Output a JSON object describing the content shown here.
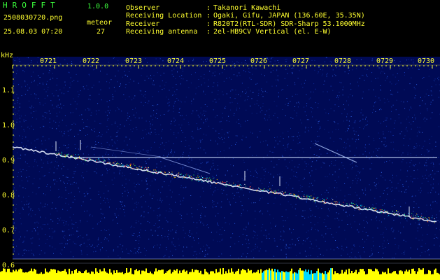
{
  "header": {
    "app_name": "HROFFT",
    "app_version": "1.0.0",
    "filename": "2508030720.png",
    "timestamp": "25.08.03 07:20",
    "counter_label": "meteor",
    "counter_value": "27",
    "fields": [
      {
        "label": "Observer",
        "value": "Takanori Kawachi"
      },
      {
        "label": "Receiving Location",
        "value": "Ogaki, Gifu, JAPAN (136.60E, 35.35N)"
      },
      {
        "label": "Receiver",
        "value": "R820T2(RTL-SDR) SDR-Sharp 53.1000MHz"
      },
      {
        "label": "Receiving antenna",
        "value": "2el-HB9CV Vertical (el. E-W)"
      }
    ]
  },
  "axes": {
    "y_unit": "kHz",
    "y_ticks": [
      "1.1",
      "1.0",
      "0.9",
      "0.8",
      "0.7",
      "0.6"
    ],
    "x_ticks": [
      "0721",
      "0722",
      "0723",
      "0724",
      "0725",
      "0726",
      "0727",
      "0728",
      "0729",
      "0730"
    ]
  },
  "colors": {
    "background": "#000000",
    "spectrogram_bg": "#000a55",
    "text_green": "#3cff3c",
    "text_yellow": "#ffff30",
    "signal_line": "#e8f0ff",
    "level_bar": "#ffff00",
    "level_bar_alt": "#00d8ff"
  }
}
